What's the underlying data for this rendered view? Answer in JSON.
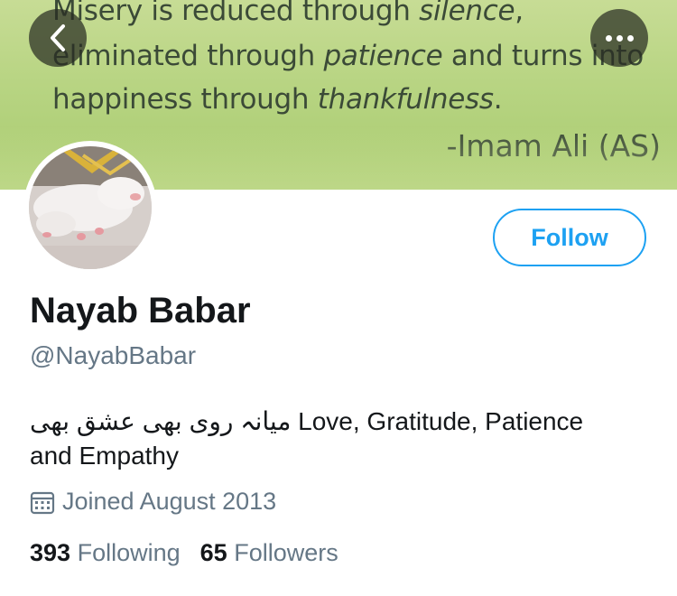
{
  "banner": {
    "quote_line1_a": "Misery is reduced through ",
    "quote_line1_b": "silence",
    "quote_line1_c": ",",
    "quote_line2_a": "eliminated through ",
    "quote_line2_b": "patience",
    "quote_line2_c": " and turns into",
    "quote_line3_a": "happiness through ",
    "quote_line3_b": "thankfulness",
    "quote_line3_c": ".",
    "quote_author": "-Imam Ali (AS)"
  },
  "nav": {
    "back_icon": "chevron-left-icon",
    "more_icon": "more-horizontal-icon"
  },
  "profile": {
    "follow_label": "Follow",
    "display_name": "Nayab Babar",
    "handle": "@NayabBabar",
    "bio_line1": "میانہ روی بھی عشق بھی Love, Gratitude, Patience",
    "bio_line2": "and Empathy",
    "joined": "Joined August 2013",
    "joined_icon": "calendar-icon",
    "following_count": "393",
    "following_label": "Following",
    "followers_count": "65",
    "followers_label": "Followers"
  },
  "colors": {
    "accent": "#1da1f2",
    "muted": "#657786",
    "text": "#14171a"
  }
}
